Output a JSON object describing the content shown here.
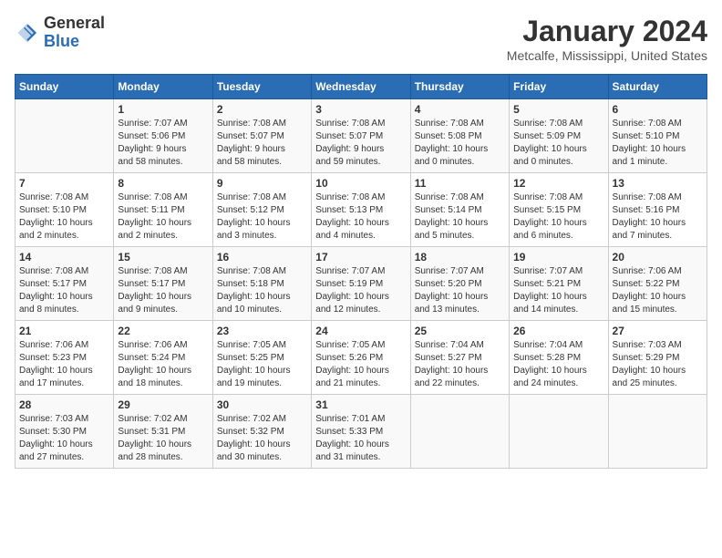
{
  "header": {
    "logo_text_general": "General",
    "logo_text_blue": "Blue",
    "month_title": "January 2024",
    "location": "Metcalfe, Mississippi, United States"
  },
  "weekdays": [
    "Sunday",
    "Monday",
    "Tuesday",
    "Wednesday",
    "Thursday",
    "Friday",
    "Saturday"
  ],
  "weeks": [
    [
      {
        "day": "",
        "info": ""
      },
      {
        "day": "1",
        "info": "Sunrise: 7:07 AM\nSunset: 5:06 PM\nDaylight: 9 hours\nand 58 minutes."
      },
      {
        "day": "2",
        "info": "Sunrise: 7:08 AM\nSunset: 5:07 PM\nDaylight: 9 hours\nand 58 minutes."
      },
      {
        "day": "3",
        "info": "Sunrise: 7:08 AM\nSunset: 5:07 PM\nDaylight: 9 hours\nand 59 minutes."
      },
      {
        "day": "4",
        "info": "Sunrise: 7:08 AM\nSunset: 5:08 PM\nDaylight: 10 hours\nand 0 minutes."
      },
      {
        "day": "5",
        "info": "Sunrise: 7:08 AM\nSunset: 5:09 PM\nDaylight: 10 hours\nand 0 minutes."
      },
      {
        "day": "6",
        "info": "Sunrise: 7:08 AM\nSunset: 5:10 PM\nDaylight: 10 hours\nand 1 minute."
      }
    ],
    [
      {
        "day": "7",
        "info": "Sunrise: 7:08 AM\nSunset: 5:10 PM\nDaylight: 10 hours\nand 2 minutes."
      },
      {
        "day": "8",
        "info": "Sunrise: 7:08 AM\nSunset: 5:11 PM\nDaylight: 10 hours\nand 2 minutes."
      },
      {
        "day": "9",
        "info": "Sunrise: 7:08 AM\nSunset: 5:12 PM\nDaylight: 10 hours\nand 3 minutes."
      },
      {
        "day": "10",
        "info": "Sunrise: 7:08 AM\nSunset: 5:13 PM\nDaylight: 10 hours\nand 4 minutes."
      },
      {
        "day": "11",
        "info": "Sunrise: 7:08 AM\nSunset: 5:14 PM\nDaylight: 10 hours\nand 5 minutes."
      },
      {
        "day": "12",
        "info": "Sunrise: 7:08 AM\nSunset: 5:15 PM\nDaylight: 10 hours\nand 6 minutes."
      },
      {
        "day": "13",
        "info": "Sunrise: 7:08 AM\nSunset: 5:16 PM\nDaylight: 10 hours\nand 7 minutes."
      }
    ],
    [
      {
        "day": "14",
        "info": "Sunrise: 7:08 AM\nSunset: 5:17 PM\nDaylight: 10 hours\nand 8 minutes."
      },
      {
        "day": "15",
        "info": "Sunrise: 7:08 AM\nSunset: 5:17 PM\nDaylight: 10 hours\nand 9 minutes."
      },
      {
        "day": "16",
        "info": "Sunrise: 7:08 AM\nSunset: 5:18 PM\nDaylight: 10 hours\nand 10 minutes."
      },
      {
        "day": "17",
        "info": "Sunrise: 7:07 AM\nSunset: 5:19 PM\nDaylight: 10 hours\nand 12 minutes."
      },
      {
        "day": "18",
        "info": "Sunrise: 7:07 AM\nSunset: 5:20 PM\nDaylight: 10 hours\nand 13 minutes."
      },
      {
        "day": "19",
        "info": "Sunrise: 7:07 AM\nSunset: 5:21 PM\nDaylight: 10 hours\nand 14 minutes."
      },
      {
        "day": "20",
        "info": "Sunrise: 7:06 AM\nSunset: 5:22 PM\nDaylight: 10 hours\nand 15 minutes."
      }
    ],
    [
      {
        "day": "21",
        "info": "Sunrise: 7:06 AM\nSunset: 5:23 PM\nDaylight: 10 hours\nand 17 minutes."
      },
      {
        "day": "22",
        "info": "Sunrise: 7:06 AM\nSunset: 5:24 PM\nDaylight: 10 hours\nand 18 minutes."
      },
      {
        "day": "23",
        "info": "Sunrise: 7:05 AM\nSunset: 5:25 PM\nDaylight: 10 hours\nand 19 minutes."
      },
      {
        "day": "24",
        "info": "Sunrise: 7:05 AM\nSunset: 5:26 PM\nDaylight: 10 hours\nand 21 minutes."
      },
      {
        "day": "25",
        "info": "Sunrise: 7:04 AM\nSunset: 5:27 PM\nDaylight: 10 hours\nand 22 minutes."
      },
      {
        "day": "26",
        "info": "Sunrise: 7:04 AM\nSunset: 5:28 PM\nDaylight: 10 hours\nand 24 minutes."
      },
      {
        "day": "27",
        "info": "Sunrise: 7:03 AM\nSunset: 5:29 PM\nDaylight: 10 hours\nand 25 minutes."
      }
    ],
    [
      {
        "day": "28",
        "info": "Sunrise: 7:03 AM\nSunset: 5:30 PM\nDaylight: 10 hours\nand 27 minutes."
      },
      {
        "day": "29",
        "info": "Sunrise: 7:02 AM\nSunset: 5:31 PM\nDaylight: 10 hours\nand 28 minutes."
      },
      {
        "day": "30",
        "info": "Sunrise: 7:02 AM\nSunset: 5:32 PM\nDaylight: 10 hours\nand 30 minutes."
      },
      {
        "day": "31",
        "info": "Sunrise: 7:01 AM\nSunset: 5:33 PM\nDaylight: 10 hours\nand 31 minutes."
      },
      {
        "day": "",
        "info": ""
      },
      {
        "day": "",
        "info": ""
      },
      {
        "day": "",
        "info": ""
      }
    ]
  ]
}
